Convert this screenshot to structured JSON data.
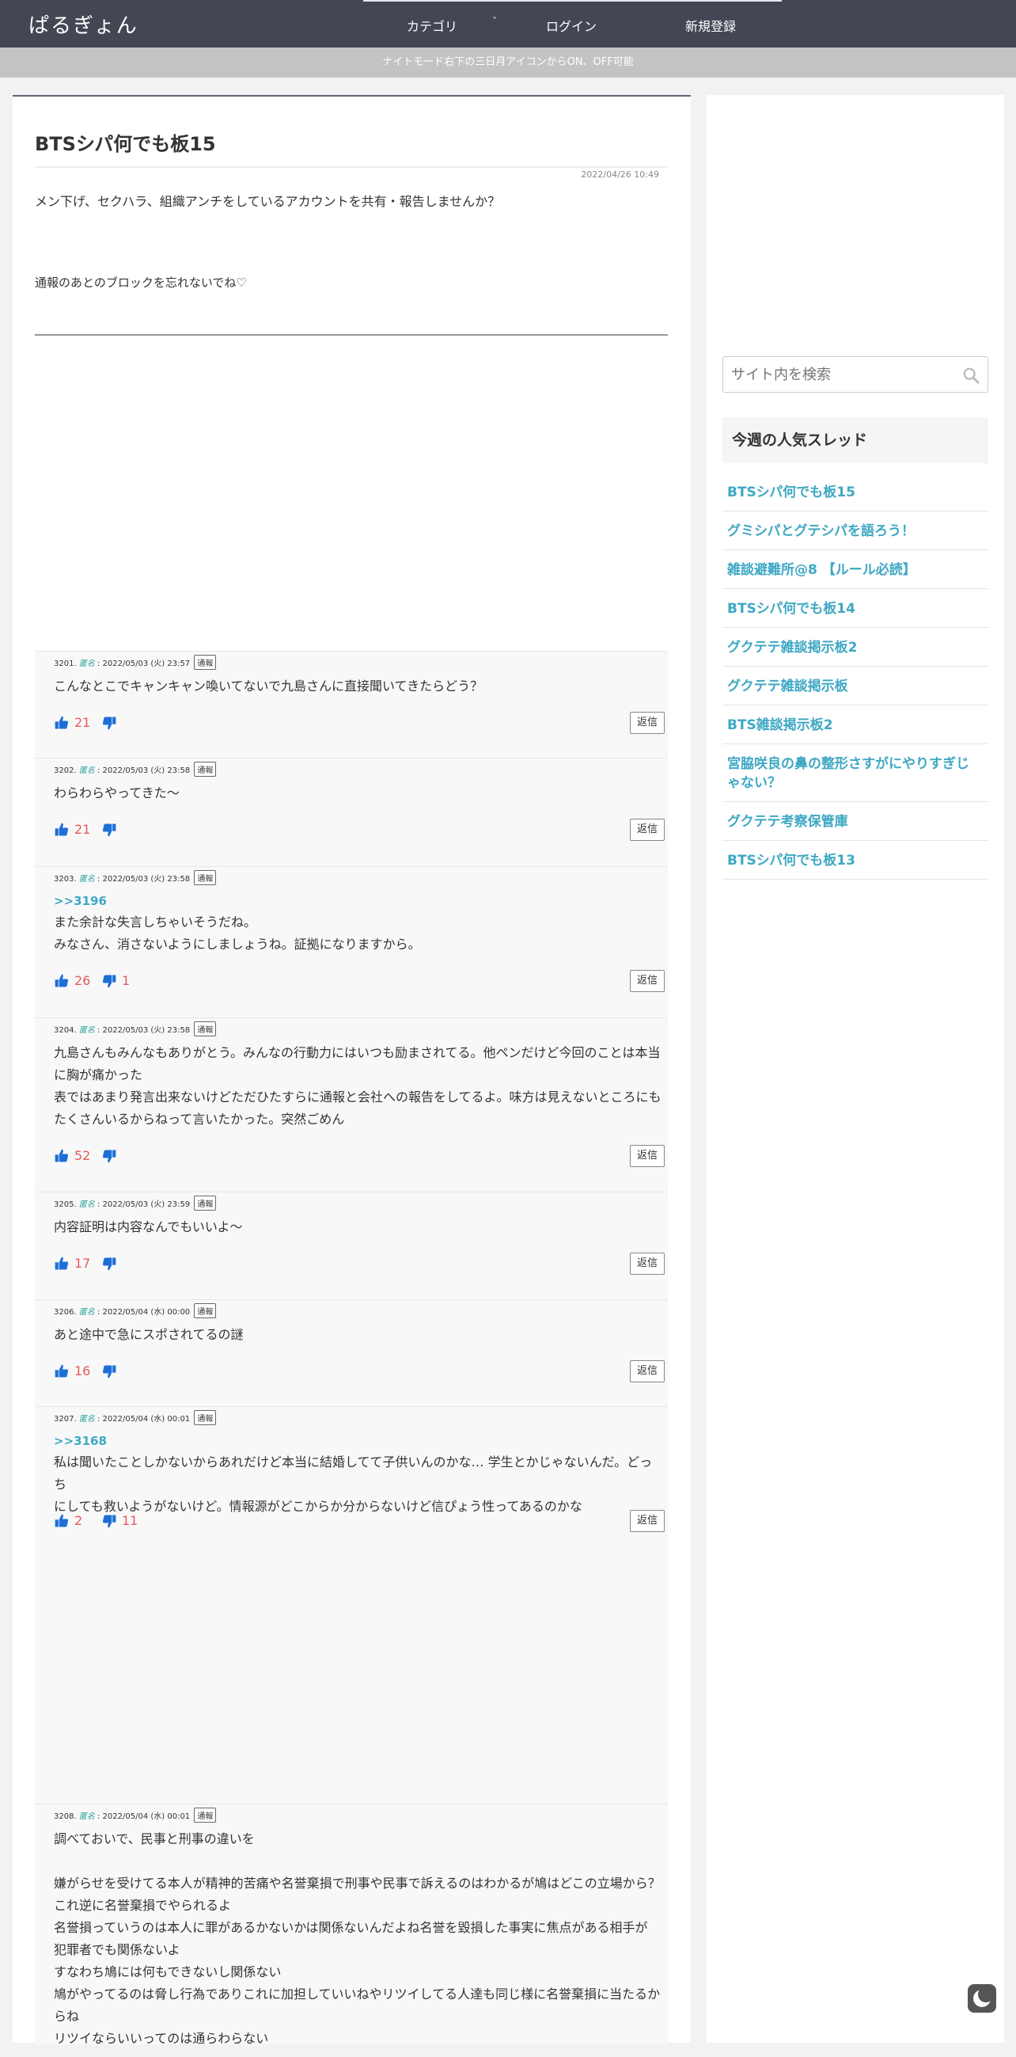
{
  "header": {
    "logo": "ぱるぎょん",
    "nav": [
      "カテゴリ",
      "ログイン",
      "新規登録"
    ],
    "caret": "ˇ"
  },
  "notice": "ナイトモード右下の三日月アイコンからON、OFF可能",
  "thread": {
    "title": "BTSシパ何でも板15",
    "date": "2022/04/26 10:49",
    "intro1": "メン下げ、セクハラ、組織アンチをしているアカウントを共有・報告しませんか？",
    "intro2": "通報のあとのブロックを忘れないでね♡"
  },
  "labels": {
    "report": "通報",
    "reply": "返信",
    "anon": "匿名"
  },
  "comments": [
    {
      "num": "3201.",
      "time": ": 2022/05/03 (火) 23:57",
      "anchor": "",
      "lines": [
        "こんなとこでキャンキャン喚いてないで九島さんに直接聞いてきたらどう？"
      ],
      "up": "21",
      "down": ""
    },
    {
      "num": "3202.",
      "time": ": 2022/05/03 (火) 23:58",
      "anchor": "",
      "lines": [
        "わらわらやってきた〜"
      ],
      "up": "21",
      "down": ""
    },
    {
      "num": "3203.",
      "time": ": 2022/05/03 (火) 23:58",
      "anchor": ">>3196",
      "lines": [
        "また余計な失言しちゃいそうだね。",
        "みなさん、消さないようにしましょうね。証拠になりますから。"
      ],
      "up": "26",
      "down": "1"
    },
    {
      "num": "3204.",
      "time": ": 2022/05/03 (火) 23:58",
      "anchor": "",
      "lines": [
        "九島さんもみんなもありがとう。みんなの行動力にはいつも励まされてる。他ペンだけど今回のことは本当",
        "に胸が痛かった",
        "表ではあまり発言出来ないけどただひたすらに通報と会社への報告をしてるよ。味方は見えないところにも",
        "たくさんいるからねって言いたかった。突然ごめん"
      ],
      "up": "52",
      "down": ""
    },
    {
      "num": "3205.",
      "time": ": 2022/05/03 (火) 23:59",
      "anchor": "",
      "lines": [
        "内容証明は内容なんでもいいよ〜"
      ],
      "up": "17",
      "down": ""
    },
    {
      "num": "3206.",
      "time": ": 2022/05/04 (水) 00:00",
      "anchor": "",
      "lines": [
        "あと途中で急にスポされてるの謎"
      ],
      "up": "16",
      "down": ""
    },
    {
      "num": "3207.",
      "time": ": 2022/05/04 (水) 00:01",
      "anchor": ">>3168",
      "lines": [
        "私は聞いたことしかないからあれだけど本当に結婚してて子供いんのかな… 学生とかじゃないんだ。どっち",
        "にしても救いようがないけど。情報源がどこからか分からないけど信ぴょう性ってあるのかな"
      ],
      "up": "2",
      "down": "11"
    },
    {
      "num": "3208.",
      "time": ": 2022/05/04 (水) 00:01",
      "anchor": "",
      "lines": [
        "調べておいで、民事と刑事の違いを",
        "",
        "嫌がらせを受けてる本人が精神的苦痛や名誉棄損で刑事や民事で訴えるのはわかるが鳩はどこの立場から？",
        "これ逆に名誉棄損でやられるよ",
        "名誉損っていうのは本人に罪があるかないかは関係ないんだよね名誉を毀損した事実に焦点がある相手が",
        "犯罪者でも関係ないよ",
        "すなわち鳩には何もできないし関係ない",
        "鳩がやってるのは脅し行為でありこれに加担していいねやリツイしてる人達も同じ様に名誉棄損に当たるか",
        "らね",
        "リツイならいいってのは通らわらない"
      ],
      "up": "",
      "down": ""
    }
  ],
  "sidebar": {
    "search_placeholder": "サイト内を検索",
    "popular_title": "今週の人気スレッド",
    "popular": [
      [
        "BTSシパ何でも板15"
      ],
      [
        "グミシパとグテシパを語ろう！"
      ],
      [
        "雑談避難所@8 【ルール必読】"
      ],
      [
        "BTSシパ何でも板14"
      ],
      [
        "グクテテ雑談掲示板2"
      ],
      [
        "グクテテ雑談掲示板"
      ],
      [
        "BTS雑談掲示板2"
      ],
      [
        "宮脇咲良の鼻の整形さすがにやりすぎじ",
        "ゃない？"
      ],
      [
        "グクテテ考察保管庫"
      ],
      [
        "BTSシパ何でも板13"
      ]
    ]
  },
  "colors": {
    "header": "#444654",
    "link": "#3ea8c4",
    "vote": "#e65a5a",
    "thumb": "#1d6fd8"
  }
}
